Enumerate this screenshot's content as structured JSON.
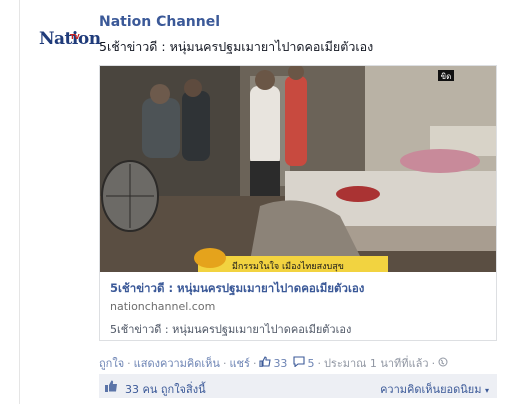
{
  "page": {
    "name": "Nation Channel",
    "avatar_text": "Nation",
    "avatar_tv": "TV"
  },
  "post": {
    "text": "5เช้าข่าวดี : หนุ่มนครปฐมเมายาไปาดคอเมียตัวเอง"
  },
  "video": {
    "watermark": "ขิด",
    "caption": "มีกรรมในใจ เมืองไทยสงบสุข"
  },
  "link": {
    "title": "5เช้าข่าวดี : หนุ่มนครปฐมเมายาไปาดคอเมียตัวเอง",
    "domain": "nationchannel.com",
    "description": "5เช้าข่าวดี : หนุ่มนครปฐมเมายาไปาดคอเมียตัวเอง"
  },
  "actions": {
    "like": "ถูกใจ",
    "comment": "แสดงความคิดเห็น",
    "share": "แชร์",
    "like_count": "33",
    "comment_count": "5",
    "timestamp": "ประมาณ 1 นาทีที่แล้ว"
  },
  "likes_bar": {
    "count_text": "33 คน ถูกใจสิ่งนี้",
    "top_comments": "ความคิดเห็นยอดนิยม"
  },
  "colors": {
    "link": "#3b5998",
    "muted": "#9197a3",
    "bar": "#edeff4"
  }
}
